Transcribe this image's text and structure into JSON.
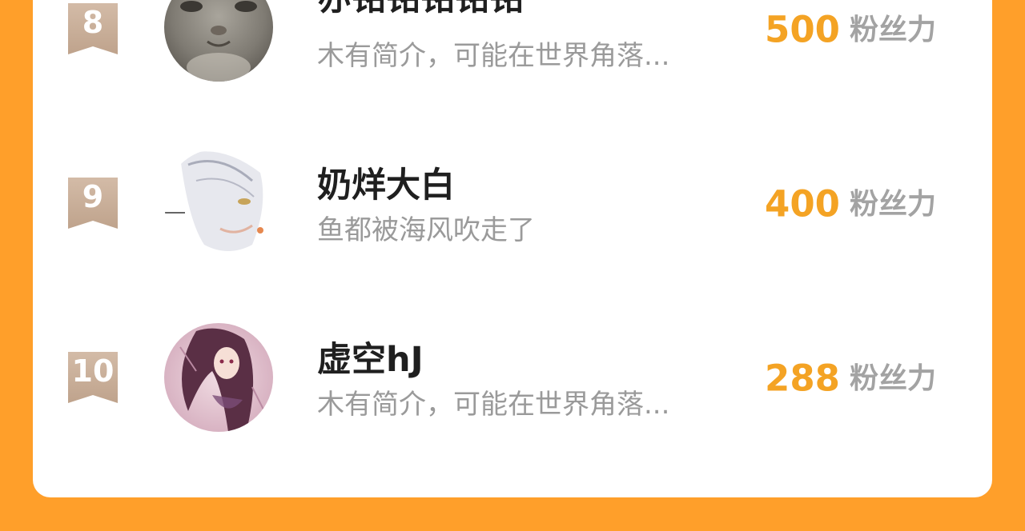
{
  "ranking": {
    "items": [
      {
        "rank": "8",
        "name": "亦铭铭铭铭铭",
        "bio": "木有简介，可能在世界角落...",
        "fans_count": "500",
        "fans_label": "粉丝力",
        "avatar": "cat-photo-avatar"
      },
      {
        "rank": "9",
        "name": "奶烊大白",
        "bio": "鱼都被海风吹走了",
        "fans_count": "400",
        "fans_label": "粉丝力",
        "avatar": "silver-haired-anime-avatar"
      },
      {
        "rank": "10",
        "name": "虚空hJ",
        "bio": "木有简介，可能在世界角落...",
        "fans_count": "288",
        "fans_label": "粉丝力",
        "avatar": "dark-haired-anime-girl-avatar"
      }
    ]
  },
  "colors": {
    "background": "#FF9F2A",
    "card": "#FFFFFF",
    "fans_count": "#F4A324",
    "rank_badge": "#C9AE98"
  }
}
